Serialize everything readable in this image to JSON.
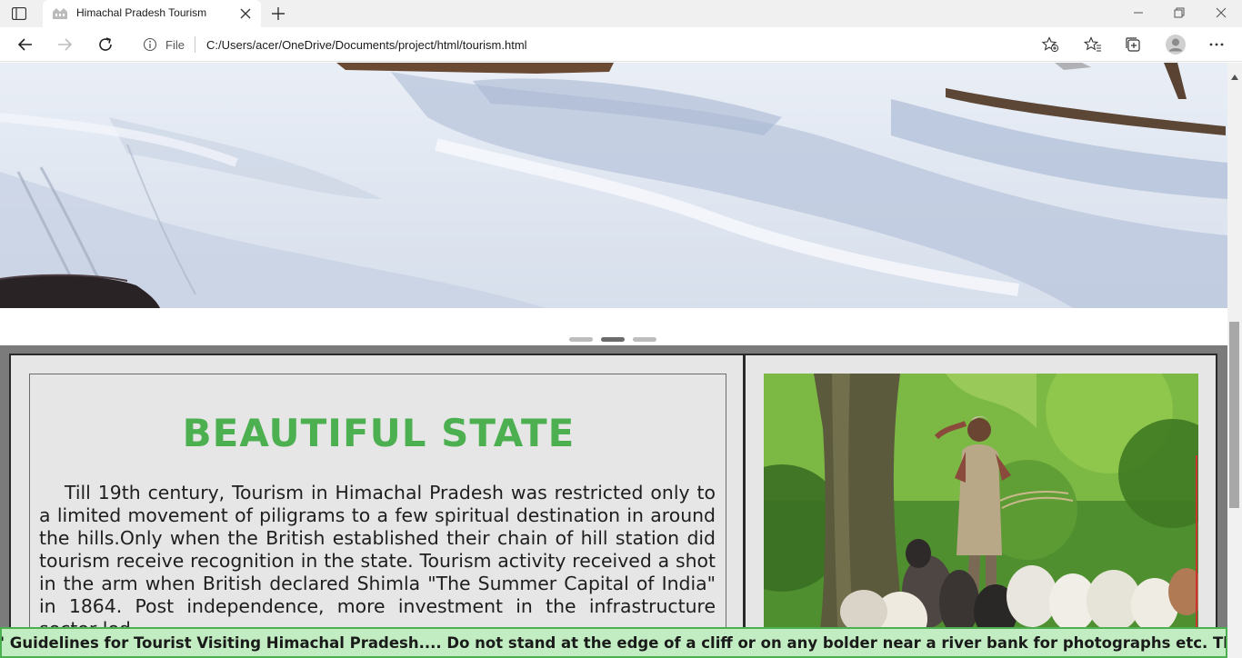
{
  "browser": {
    "tab_title": "Himachal Pradesh Tourism",
    "address_scheme_label": "File",
    "url": "C:/Users/acer/OneDrive/Documents/project/html/tourism.html"
  },
  "carousel": {
    "slide_count": 3,
    "active_index": 1
  },
  "article": {
    "heading": "BEAUTIFUL STATE",
    "body": "Till 19th century, Tourism in Himachal Pradesh was restricted only to a limited movement of piligrams to a few spiritual destination in around the hills.Only when the British established their chain of hill station did tourism receive recognition in the state. Tourism activity received a shot in the arm when British declared Shimla \"The Summer Capital of India\" in 1864. Post independence, more investment in the infrastructure sector led"
  },
  "marquee": {
    "text": "' Guidelines for Tourist Visiting Himachal Pradesh.... Do not stand at the edge of a cliff or on any bolder near a river bank for photographs etc. The wa"
  },
  "colors": {
    "accent_green": "#4caf50",
    "marquee_bg": "#c2edc2",
    "content_bg": "#7b7b7b"
  }
}
